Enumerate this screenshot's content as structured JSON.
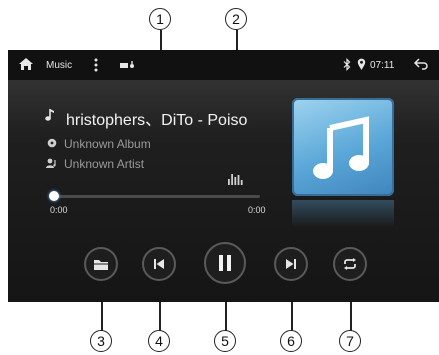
{
  "callouts": [
    "1",
    "2",
    "3",
    "4",
    "5",
    "6",
    "7"
  ],
  "statusbar": {
    "title": "Music",
    "clock": "07:11",
    "icons": [
      "home-icon",
      "menu-dots-icon",
      "signal-icon",
      "bluetooth-icon",
      "location-pin-icon",
      "back-icon"
    ]
  },
  "track": {
    "title": "hristophers、DiTo - Poiso",
    "album": "Unknown Album",
    "artist": "Unknown Artist",
    "elapsed": "0:00",
    "duration": "0:00",
    "progress": 0
  },
  "controls": [
    "folder-icon",
    "previous-icon",
    "pause-icon",
    "next-icon",
    "repeat-icon"
  ],
  "colors": {
    "accent": "#4aa3e8",
    "art": "#5aa7d8",
    "background": "#1b1b1b"
  }
}
